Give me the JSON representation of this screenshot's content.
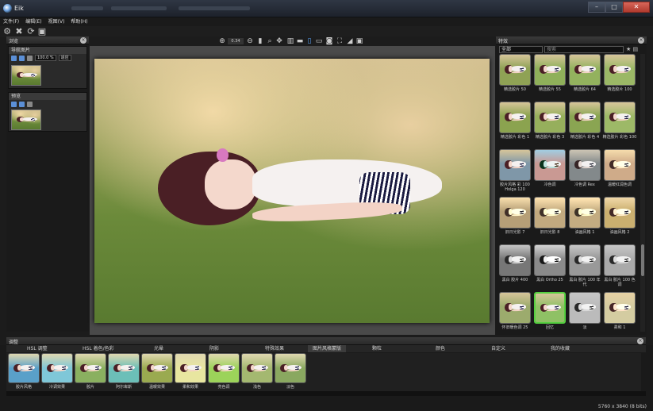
{
  "window": {
    "title": "Eik"
  },
  "menu": [
    {
      "label": "文件(F)"
    },
    {
      "label": "编辑(E)"
    },
    {
      "label": "视图(V)"
    },
    {
      "label": "帮助(H)"
    }
  ],
  "left_panel": {
    "header": "浏览",
    "source": {
      "title": "导航图片",
      "zoom": "100.0 %",
      "fit_label": "适应"
    },
    "compare": {
      "title": "预览"
    }
  },
  "view": {
    "zoom": "0.34"
  },
  "right_panel": {
    "header": "特效",
    "category_select": "全部",
    "search_placeholder": "搜索",
    "presets": [
      {
        "label": "精选胶片 50"
      },
      {
        "label": "精选胶片 55"
      },
      {
        "label": "精选胶片 64"
      },
      {
        "label": "精选胶片 100"
      },
      {
        "label": "精选胶片 彩色 1"
      },
      {
        "label": "精选胶片 彩色 3"
      },
      {
        "label": "精选胶片 彩色 4"
      },
      {
        "label": "精选胶片 彩色 100"
      },
      {
        "label": "胶片风格 彩 100 Holga 120"
      },
      {
        "label": "冷色调"
      },
      {
        "label": "冷色调 Rex"
      },
      {
        "label": "温暖红润色调"
      },
      {
        "label": "旧日光影 7"
      },
      {
        "label": "旧日光影 8"
      },
      {
        "label": "油画风格 1"
      },
      {
        "label": "油画风格 2"
      },
      {
        "label": "黑白 胶片 400"
      },
      {
        "label": "黑白 Ortho 25"
      },
      {
        "label": "黑白 胶片 100 年代"
      },
      {
        "label": "黑白 胶片 100 色调"
      },
      {
        "label": "怀旧暖色调 25"
      },
      {
        "label": "回忆"
      },
      {
        "label": "淡"
      },
      {
        "label": "柔和 1"
      }
    ]
  },
  "bottom": {
    "header": "调整",
    "tabs": [
      {
        "label": "HSL 调整"
      },
      {
        "label": "HSL 着色/色彩"
      },
      {
        "label": "光晕"
      },
      {
        "label": "阴影"
      },
      {
        "label": "特殊效果"
      },
      {
        "label": "图片风格蒙版"
      },
      {
        "label": "颗粒"
      },
      {
        "label": "颜色"
      },
      {
        "label": "自定义"
      },
      {
        "label": "我的收藏"
      }
    ],
    "film": [
      {
        "label": "胶片风格"
      },
      {
        "label": "冷调效果"
      },
      {
        "label": "胶片"
      },
      {
        "label": "阿尔卑斯"
      },
      {
        "label": "温暖效果"
      },
      {
        "label": "柔和效果"
      },
      {
        "label": "亮色调"
      },
      {
        "label": "浅色"
      },
      {
        "label": "淡色"
      }
    ],
    "status": "5760 x 3840 (8 bits)"
  }
}
